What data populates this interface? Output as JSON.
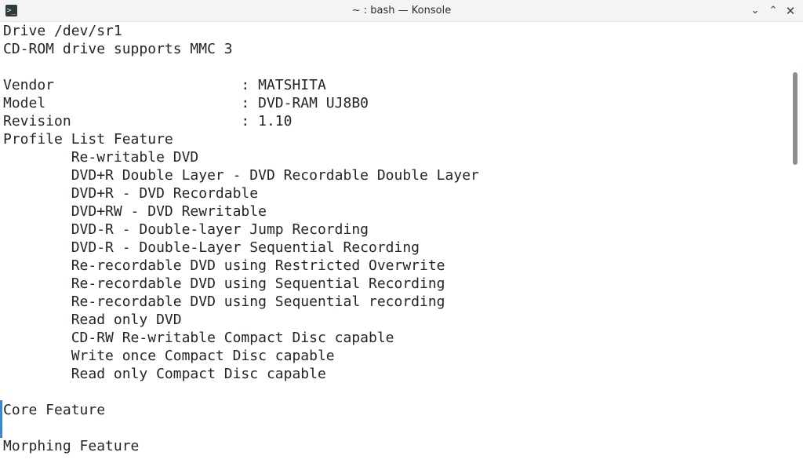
{
  "window": {
    "title": "~ : bash — Konsole",
    "app_icon": ">_",
    "controls": {
      "minimize": "⌄",
      "maximize": "⌃",
      "close": "✕"
    }
  },
  "terminal": {
    "lines": [
      "Drive /dev/sr1",
      "CD-ROM drive supports MMC 3",
      "",
      "Vendor                      : MATSHITA",
      "Model                       : DVD-RAM UJ8B0",
      "Revision                    : 1.10",
      "Profile List Feature",
      "        Re-writable DVD",
      "        DVD+R Double Layer - DVD Recordable Double Layer",
      "        DVD+R - DVD Recordable",
      "        DVD+RW - DVD Rewritable",
      "        DVD-R - Double-layer Jump Recording",
      "        DVD-R - Double-Layer Sequential Recording",
      "        Re-recordable DVD using Restricted Overwrite",
      "        Re-recordable DVD using Sequential Recording",
      "        Re-recordable DVD using Sequential recording",
      "        Read only DVD",
      "        CD-RW Re-writable Compact Disc capable",
      "        Write once Compact Disc capable",
      "        Read only Compact Disc capable",
      "",
      "Core Feature",
      "",
      "Morphing Feature"
    ]
  },
  "colors": {
    "background": "#ffffff",
    "text": "#232627",
    "accent": "#3b87c9",
    "scrollbar": "#8c8f91"
  }
}
